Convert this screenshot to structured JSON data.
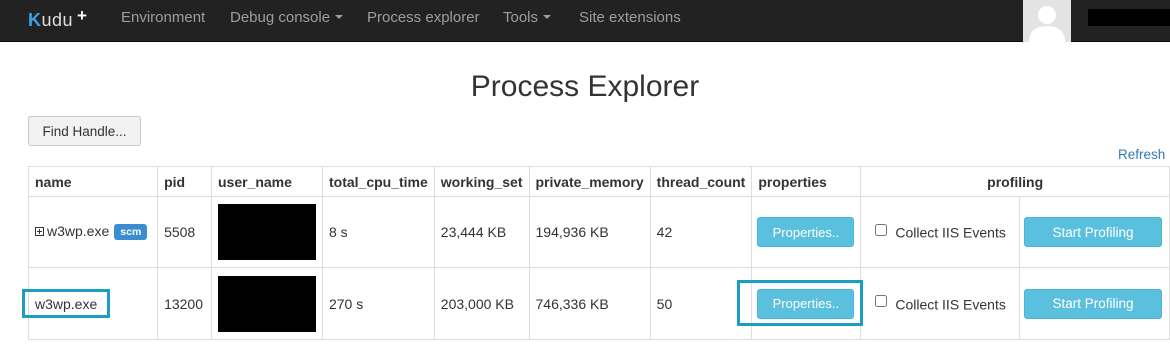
{
  "navbar": {
    "brand": {
      "k": "K",
      "rest": "udu",
      "plus": "+"
    },
    "items": [
      {
        "label": "Environment",
        "has_caret": false
      },
      {
        "label": "Debug console",
        "has_caret": true
      },
      {
        "label": "Process explorer",
        "has_caret": false
      },
      {
        "label": "Tools",
        "has_caret": true
      },
      {
        "label": "Site extensions",
        "has_caret": false
      }
    ],
    "avatar_icon": "user-avatar-icon"
  },
  "page": {
    "title": "Process Explorer",
    "find_handle_label": "Find Handle...",
    "refresh_label": "Refresh"
  },
  "table": {
    "headers": [
      "name",
      "pid",
      "user_name",
      "total_cpu_time",
      "working_set",
      "private_memory",
      "thread_count",
      "properties",
      "profiling"
    ],
    "rows": [
      {
        "name": "w3wp.exe",
        "has_expander": true,
        "badge": "scm",
        "pid": "5508",
        "user_name_redacted": true,
        "total_cpu_time": "8 s",
        "working_set": "23,444 KB",
        "private_memory": "194,936 KB",
        "thread_count": "42",
        "properties_label": "Properties..",
        "collect_label": "Collect IIS Events",
        "collect_checked": false,
        "profiling_label": "Start Profiling"
      },
      {
        "name": "w3wp.exe",
        "has_expander": false,
        "badge": "",
        "pid": "13200",
        "user_name_redacted": true,
        "total_cpu_time": "270 s",
        "working_set": "203,000 KB",
        "private_memory": "746,336 KB",
        "thread_count": "50",
        "properties_label": "Properties..",
        "collect_label": "Collect IIS Events",
        "collect_checked": false,
        "profiling_label": "Start Profiling"
      }
    ]
  },
  "colors": {
    "navbar_bg": "#222222",
    "accent_button": "#5bc0de",
    "highlight_box": "#1a9ec2",
    "link": "#337ab7"
  }
}
